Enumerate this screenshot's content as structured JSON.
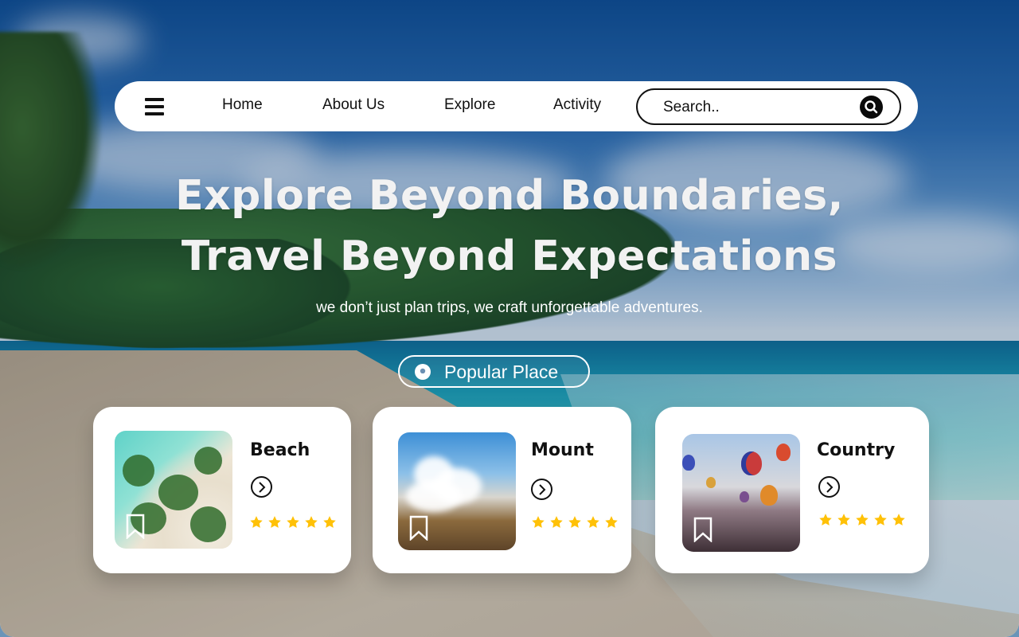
{
  "nav": {
    "links": [
      "Home",
      "About Us",
      "Explore",
      "Activity"
    ],
    "search_placeholder": "Search.."
  },
  "hero": {
    "title_line1": "Explore Beyond Boundaries,",
    "title_line2": "Travel Beyond Expectations",
    "subtitle": "we don’t just plan trips, we craft unforgettable adventures.",
    "popular_label": "Popular Place"
  },
  "cards": [
    {
      "title": "Beach",
      "rating": 5
    },
    {
      "title": "Mount",
      "rating": 5
    },
    {
      "title": "Country",
      "rating": 5
    }
  ],
  "colors": {
    "star": "#FFC107",
    "nav_bg": "#FFFFFF",
    "text": "#111111"
  },
  "icons": [
    "menu-icon",
    "search-icon",
    "location-pin-icon",
    "chevron-right-icon",
    "bookmark-icon",
    "star-icon"
  ]
}
